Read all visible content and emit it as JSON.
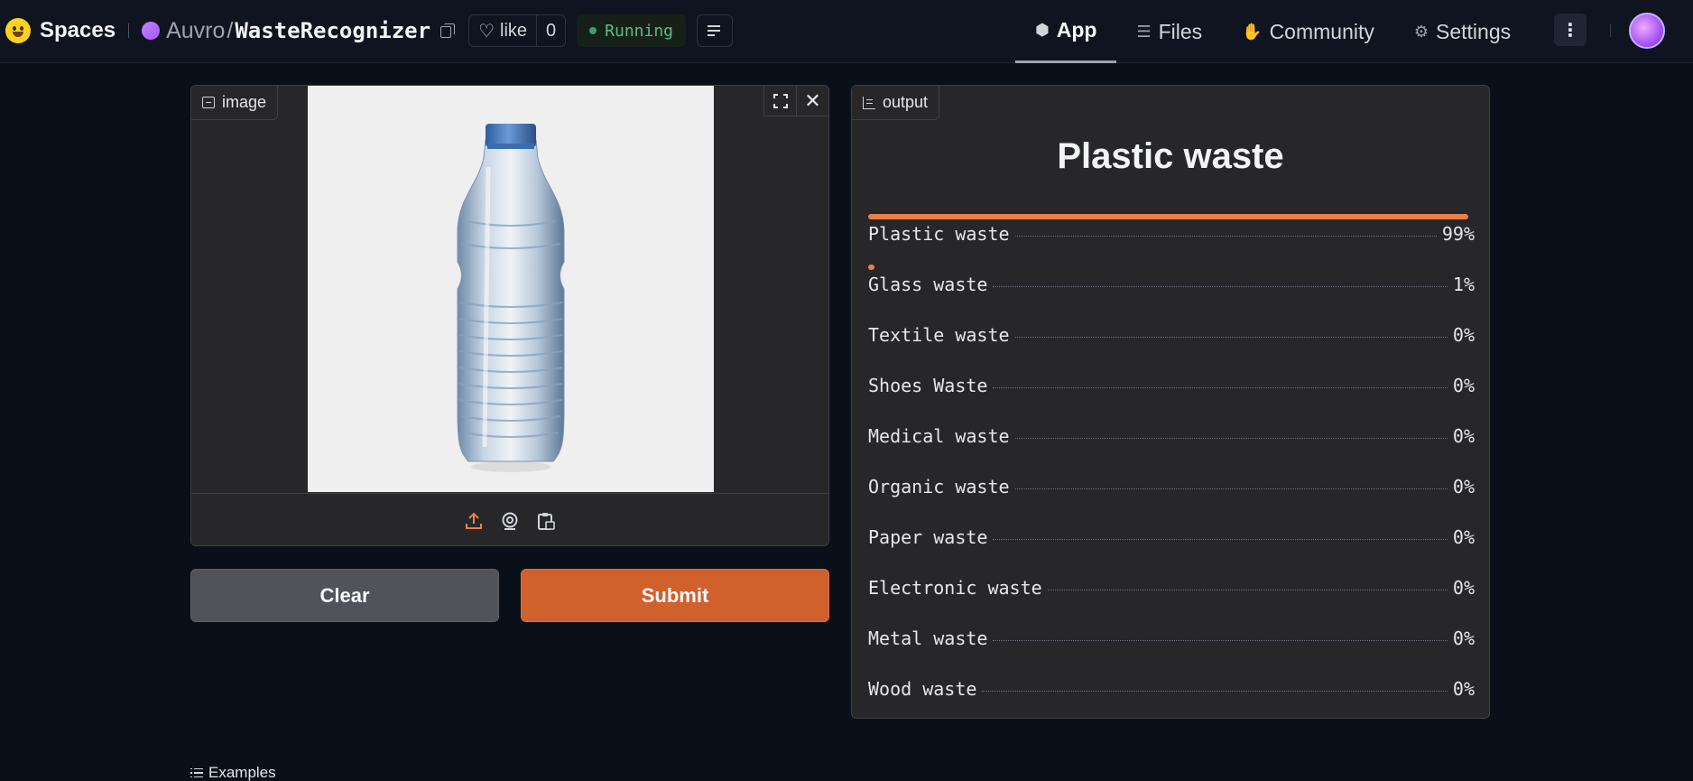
{
  "nav": {
    "brand": "Spaces",
    "owner": "Auvro",
    "separator": "/",
    "repo": "WasteRecognizer",
    "like_label": "like",
    "like_count": "0",
    "status": "Running",
    "tabs": [
      {
        "label": "App",
        "icon": "cube-icon",
        "active": true
      },
      {
        "label": "Files",
        "icon": "files-icon",
        "active": false
      },
      {
        "label": "Community",
        "icon": "hands-icon",
        "active": false
      },
      {
        "label": "Settings",
        "icon": "gear-icon",
        "active": false
      }
    ]
  },
  "input_panel": {
    "label": "image",
    "image_subject": "plastic water bottle with blue cap",
    "sources": [
      "upload-icon",
      "webcam-icon",
      "clipboard-icon"
    ]
  },
  "buttons": {
    "clear": "Clear",
    "submit": "Submit"
  },
  "output_panel": {
    "label": "output",
    "top_label": "Plastic waste",
    "confidences": [
      {
        "label": "Plastic waste",
        "value": "99%",
        "fraction": 0.99
      },
      {
        "label": "Glass waste",
        "value": "1%",
        "fraction": 0.01
      },
      {
        "label": "Textile waste",
        "value": "0%",
        "fraction": 0
      },
      {
        "label": "Shoes Waste",
        "value": "0%",
        "fraction": 0
      },
      {
        "label": "Medical waste",
        "value": "0%",
        "fraction": 0
      },
      {
        "label": "Organic waste",
        "value": "0%",
        "fraction": 0
      },
      {
        "label": "Paper waste",
        "value": "0%",
        "fraction": 0
      },
      {
        "label": "Electronic waste",
        "value": "0%",
        "fraction": 0
      },
      {
        "label": "Metal waste",
        "value": "0%",
        "fraction": 0
      },
      {
        "label": "Wood waste",
        "value": "0%",
        "fraction": 0
      }
    ]
  },
  "examples_label": "Examples",
  "colors": {
    "accent": "#d0602c",
    "bar": "#e8804a",
    "status_green": "#5eb98a",
    "background": "#0b0f19",
    "panel": "#27272a"
  }
}
